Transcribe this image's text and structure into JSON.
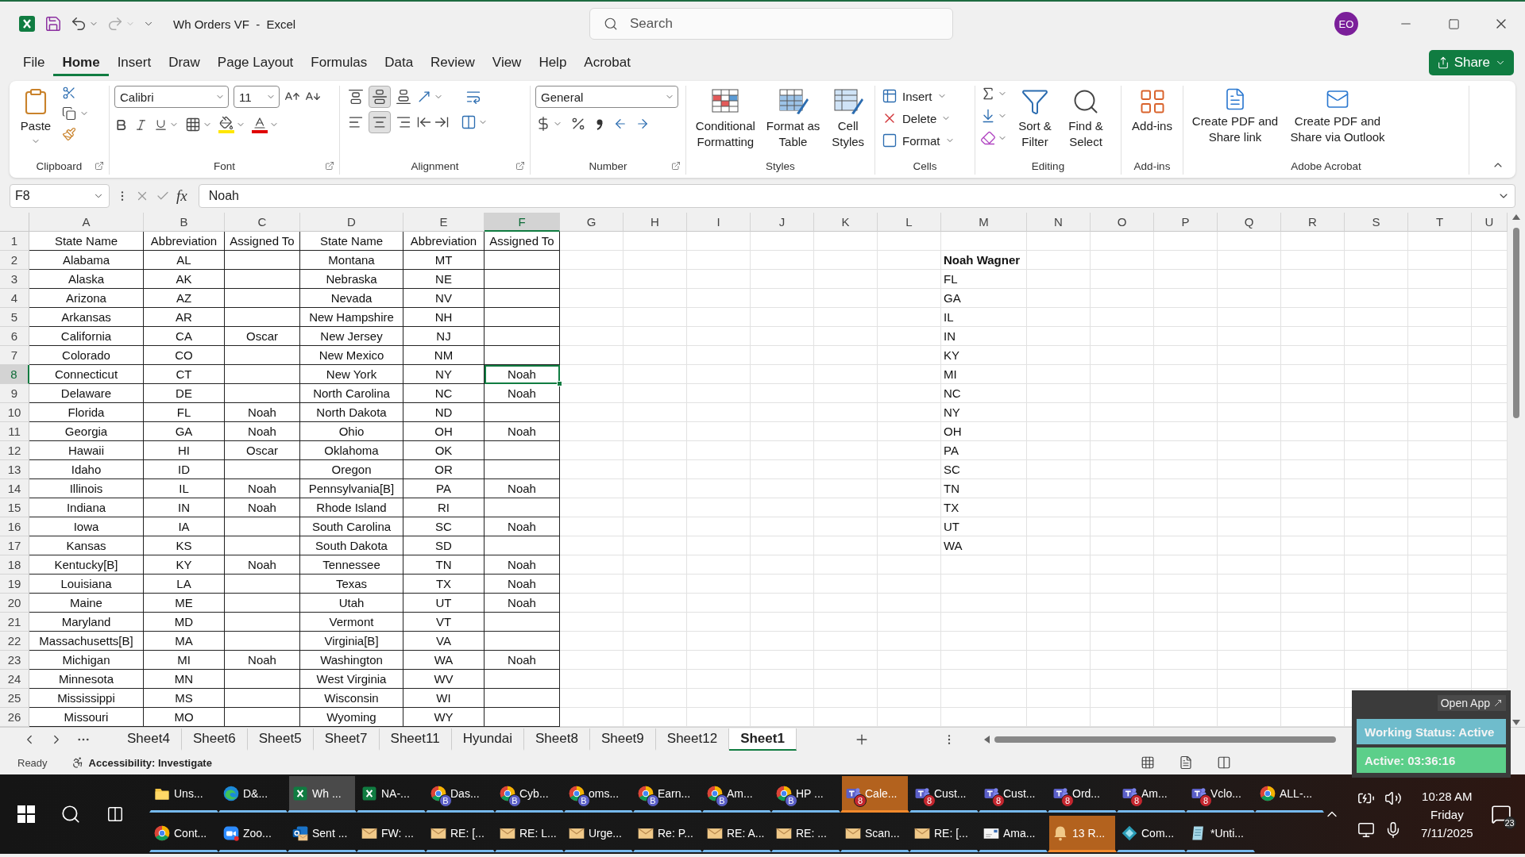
{
  "title_bar": {
    "title": "Wh Orders VF  -  Excel",
    "search_placeholder": "Search",
    "avatar": "EO"
  },
  "menu_tabs": [
    {
      "label": "File",
      "selected": false
    },
    {
      "label": "Home",
      "selected": true
    },
    {
      "label": "Insert",
      "selected": false
    },
    {
      "label": "Draw",
      "selected": false
    },
    {
      "label": "Page Layout",
      "selected": false
    },
    {
      "label": "Formulas",
      "selected": false
    },
    {
      "label": "Data",
      "selected": false
    },
    {
      "label": "Review",
      "selected": false
    },
    {
      "label": "View",
      "selected": false
    },
    {
      "label": "Help",
      "selected": false
    },
    {
      "label": "Acrobat",
      "selected": false
    }
  ],
  "share_button": "Share",
  "ribbon": {
    "groups": [
      {
        "kind": "clipboard",
        "label": "Clipboard",
        "launcher": true,
        "buttons": [
          "Paste"
        ]
      },
      {
        "kind": "font",
        "label": "Font",
        "launcher": true,
        "font_name": "Calibri",
        "font_size": "11"
      },
      {
        "kind": "alignment",
        "label": "Alignment",
        "launcher": true,
        "vertical_buttons": [
          {
            "selected": false
          },
          {
            "selected": true
          },
          {
            "selected": false
          }
        ],
        "horizontal_buttons": [
          {
            "selected": false
          },
          {
            "selected": true
          },
          {
            "selected": false
          }
        ]
      },
      {
        "kind": "number",
        "label": "Number",
        "launcher": true,
        "format": "General"
      },
      {
        "kind": "styles",
        "label": "Styles",
        "buttons": [
          "Conditional Formatting",
          "Format as Table",
          "Cell Styles"
        ]
      },
      {
        "kind": "cells",
        "label": "Cells",
        "buttons": [
          "Insert",
          "Delete",
          "Format"
        ]
      },
      {
        "kind": "editing",
        "label": "Editing",
        "buttons": [
          "Sort & Filter",
          "Find & Select"
        ]
      },
      {
        "kind": "addins",
        "label": "Add-ins",
        "buttons": [
          "Add-ins"
        ]
      },
      {
        "kind": "acrobat",
        "label": "Adobe Acrobat",
        "buttons": [
          "Create PDF and Share link",
          "Create PDF and Share via Outlook"
        ]
      }
    ]
  },
  "formula_bar": {
    "name_box": "F8",
    "fx": "fx",
    "value": "Noah"
  },
  "sheet": {
    "columns": [
      {
        "letter": "A",
        "selected": false
      },
      {
        "letter": "B",
        "selected": false
      },
      {
        "letter": "C",
        "selected": false
      },
      {
        "letter": "D",
        "selected": false
      },
      {
        "letter": "E",
        "selected": false
      },
      {
        "letter": "F",
        "selected": true
      },
      {
        "letter": "G",
        "selected": false
      },
      {
        "letter": "H",
        "selected": false
      },
      {
        "letter": "I",
        "selected": false
      },
      {
        "letter": "J",
        "selected": false
      },
      {
        "letter": "K",
        "selected": false
      },
      {
        "letter": "L",
        "selected": false
      },
      {
        "letter": "M",
        "selected": false
      },
      {
        "letter": "N",
        "selected": false
      },
      {
        "letter": "O",
        "selected": false
      },
      {
        "letter": "P",
        "selected": false
      },
      {
        "letter": "Q",
        "selected": false
      },
      {
        "letter": "R",
        "selected": false
      },
      {
        "letter": "S",
        "selected": false
      },
      {
        "letter": "T",
        "selected": false
      },
      {
        "letter": "U",
        "selected": false
      }
    ],
    "rows": [
      {
        "number": "1",
        "selected": false,
        "cells": {
          "A": "State Name",
          "B": "Abbreviation",
          "C": "Assigned To",
          "D": "State Name",
          "E": "Abbreviation",
          "F": "Assigned To"
        }
      },
      {
        "number": "2",
        "selected": false,
        "cells": {
          "A": "Alabama",
          "B": "AL",
          "D": "Montana",
          "E": "MT",
          "M": {
            "text": "Noah Wagner",
            "bold": true
          }
        }
      },
      {
        "number": "3",
        "selected": false,
        "cells": {
          "A": "Alaska",
          "B": "AK",
          "D": "Nebraska",
          "E": "NE",
          "M": "FL"
        }
      },
      {
        "number": "4",
        "selected": false,
        "cells": {
          "A": "Arizona",
          "B": "AZ",
          "D": "Nevada",
          "E": "NV",
          "M": "GA"
        }
      },
      {
        "number": "5",
        "selected": false,
        "cells": {
          "A": "Arkansas",
          "B": "AR",
          "D": "New Hampshire",
          "E": "NH",
          "M": "IL"
        }
      },
      {
        "number": "6",
        "selected": false,
        "cells": {
          "A": "California",
          "B": "CA",
          "C": "Oscar",
          "D": "New Jersey",
          "E": "NJ",
          "M": "IN"
        }
      },
      {
        "number": "7",
        "selected": false,
        "cells": {
          "A": "Colorado",
          "B": "CO",
          "D": "New Mexico",
          "E": "NM",
          "M": "KY"
        }
      },
      {
        "number": "8",
        "selected": true,
        "cells": {
          "A": "Connecticut",
          "B": "CT",
          "D": "New York",
          "E": "NY",
          "F": "Noah",
          "M": "MI"
        }
      },
      {
        "number": "9",
        "selected": false,
        "cells": {
          "A": "Delaware",
          "B": "DE",
          "D": "North Carolina",
          "E": "NC",
          "F": "Noah",
          "M": "NC"
        }
      },
      {
        "number": "10",
        "selected": false,
        "cells": {
          "A": "Florida",
          "B": "FL",
          "C": "Noah",
          "D": "North Dakota",
          "E": "ND",
          "M": "NY"
        }
      },
      {
        "number": "11",
        "selected": false,
        "cells": {
          "A": "Georgia",
          "B": "GA",
          "C": "Noah",
          "D": "Ohio",
          "E": "OH",
          "F": "Noah",
          "M": "OH"
        }
      },
      {
        "number": "12",
        "selected": false,
        "cells": {
          "A": "Hawaii",
          "B": "HI",
          "C": "Oscar",
          "D": "Oklahoma",
          "E": "OK",
          "M": "PA"
        }
      },
      {
        "number": "13",
        "selected": false,
        "cells": {
          "A": "Idaho",
          "B": "ID",
          "D": "Oregon",
          "E": "OR",
          "M": "SC"
        }
      },
      {
        "number": "14",
        "selected": false,
        "cells": {
          "A": "Illinois",
          "B": "IL",
          "C": "Noah",
          "D": "Pennsylvania[B]",
          "E": "PA",
          "F": "Noah",
          "M": "TN"
        }
      },
      {
        "number": "15",
        "selected": false,
        "cells": {
          "A": "Indiana",
          "B": "IN",
          "C": "Noah",
          "D": "Rhode Island",
          "E": "RI",
          "M": "TX"
        }
      },
      {
        "number": "16",
        "selected": false,
        "cells": {
          "A": "Iowa",
          "B": "IA",
          "D": "South Carolina",
          "E": "SC",
          "F": "Noah",
          "M": "UT"
        }
      },
      {
        "number": "17",
        "selected": false,
        "cells": {
          "A": "Kansas",
          "B": "KS",
          "D": "South Dakota",
          "E": "SD",
          "M": "WA"
        }
      },
      {
        "number": "18",
        "selected": false,
        "cells": {
          "A": "Kentucky[B]",
          "B": "KY",
          "C": "Noah",
          "D": "Tennessee",
          "E": "TN",
          "F": "Noah"
        }
      },
      {
        "number": "19",
        "selected": false,
        "cells": {
          "A": "Louisiana",
          "B": "LA",
          "D": "Texas",
          "E": "TX",
          "F": "Noah"
        }
      },
      {
        "number": "20",
        "selected": false,
        "cells": {
          "A": "Maine",
          "B": "ME",
          "D": "Utah",
          "E": "UT",
          "F": "Noah"
        }
      },
      {
        "number": "21",
        "selected": false,
        "cells": {
          "A": "Maryland",
          "B": "MD",
          "D": "Vermont",
          "E": "VT"
        }
      },
      {
        "number": "22",
        "selected": false,
        "cells": {
          "A": "Massachusetts[B]",
          "B": "MA",
          "D": "Virginia[B]",
          "E": "VA"
        }
      },
      {
        "number": "23",
        "selected": false,
        "cells": {
          "A": "Michigan",
          "B": "MI",
          "C": "Noah",
          "D": "Washington",
          "E": "WA",
          "F": "Noah"
        }
      },
      {
        "number": "24",
        "selected": false,
        "cells": {
          "A": "Minnesota",
          "B": "MN",
          "D": "West Virginia",
          "E": "WV"
        }
      },
      {
        "number": "25",
        "selected": false,
        "cells": {
          "A": "Mississippi",
          "B": "MS",
          "D": "Wisconsin",
          "E": "WI"
        }
      },
      {
        "number": "26",
        "selected": false,
        "cells": {
          "A": "Missouri",
          "B": "MO",
          "D": "Wyoming",
          "E": "WY"
        }
      }
    ]
  },
  "sheet_tabs": [
    {
      "label": "Sheet4",
      "selected": false
    },
    {
      "label": "Sheet6",
      "selected": false
    },
    {
      "label": "Sheet5",
      "selected": false
    },
    {
      "label": "Sheet7",
      "selected": false
    },
    {
      "label": "Sheet11",
      "selected": false
    },
    {
      "label": "Hyundai",
      "selected": false
    },
    {
      "label": "Sheet8",
      "selected": false
    },
    {
      "label": "Sheet9",
      "selected": false
    },
    {
      "label": "Sheet12",
      "selected": false
    },
    {
      "label": "Sheet1",
      "selected": true
    }
  ],
  "status_bar": {
    "mode": "Ready",
    "accessibility": "Accessibility: Investigate"
  },
  "tracker_widget": {
    "open_app": "Open App",
    "status": "Working Status: Active",
    "timer": "Active: 03:36:16"
  },
  "taskbar": {
    "rows": [
      [
        {
          "kind": "folder",
          "label": "Uns...",
          "selected": false,
          "attention": false
        },
        {
          "kind": "edge",
          "label": "D&...",
          "selected": false,
          "attention": false
        },
        {
          "kind": "excel",
          "label": "Wh ...",
          "selected": true,
          "attention": false
        },
        {
          "kind": "excel",
          "label": "NA-...",
          "selected": false,
          "attention": false
        },
        {
          "kind": "chrome",
          "badge": "B",
          "label": "Das...",
          "selected": false,
          "attention": false
        },
        {
          "kind": "chrome",
          "badge": "B",
          "label": "Cyb...",
          "selected": false,
          "attention": false
        },
        {
          "kind": "chrome",
          "badge": "B",
          "label": "oms...",
          "selected": false,
          "attention": false
        },
        {
          "kind": "chrome",
          "badge": "B",
          "label": "Earn...",
          "selected": false,
          "attention": false
        },
        {
          "kind": "chrome",
          "badge": "B",
          "label": "Am...",
          "selected": false,
          "attention": false
        },
        {
          "kind": "chrome",
          "badge": "B",
          "label": "HP ...",
          "selected": false,
          "attention": false
        },
        {
          "kind": "teams",
          "badge": "8",
          "label": "Cale...",
          "selected": false,
          "attention": true
        },
        {
          "kind": "teams",
          "badge": "8",
          "label": "Cust...",
          "selected": false,
          "attention": false
        },
        {
          "kind": "teams",
          "badge": "8",
          "label": "Cust...",
          "selected": false,
          "attention": false
        },
        {
          "kind": "teams",
          "badge": "8",
          "label": "Ord...",
          "selected": false,
          "attention": false
        },
        {
          "kind": "teams",
          "badge": "8",
          "label": "Am...",
          "selected": false,
          "attention": false
        },
        {
          "kind": "teams",
          "badge": "8",
          "label": "Vclo...",
          "selected": false,
          "attention": false
        },
        {
          "kind": "chrome",
          "label": "ALL-...",
          "selected": false,
          "attention": false
        }
      ],
      [
        {
          "kind": "chrome",
          "label": "Cont...",
          "selected": false,
          "attention": false
        },
        {
          "kind": "zoom",
          "label": "Zoo...",
          "selected": false,
          "attention": false
        },
        {
          "kind": "outlook",
          "label": "Sent ...",
          "selected": false,
          "attention": false
        },
        {
          "kind": "mail",
          "label": "FW: ...",
          "selected": false,
          "attention": false
        },
        {
          "kind": "mail",
          "label": "RE: [...",
          "selected": false,
          "attention": false
        },
        {
          "kind": "mail",
          "label": "RE: L...",
          "selected": false,
          "attention": false
        },
        {
          "kind": "mail",
          "label": "Urge...",
          "selected": false,
          "attention": false
        },
        {
          "kind": "mail",
          "label": "Re: P...",
          "selected": false,
          "attention": false
        },
        {
          "kind": "mail",
          "label": "RE: A...",
          "selected": false,
          "attention": false
        },
        {
          "kind": "mail",
          "label": "RE: ...",
          "selected": false,
          "attention": false
        },
        {
          "kind": "mail",
          "label": "Scan...",
          "selected": false,
          "attention": false
        },
        {
          "kind": "mail",
          "label": "RE: [...",
          "selected": false,
          "attention": false
        },
        {
          "kind": "letter",
          "label": "Ama...",
          "selected": false,
          "attention": false
        },
        {
          "kind": "bell",
          "label": "13 R...",
          "selected": false,
          "attention": true
        },
        {
          "kind": "diamond",
          "label": "Com...",
          "selected": false,
          "attention": false
        },
        {
          "kind": "notepad",
          "label": "*Unti...",
          "selected": false,
          "attention": false
        }
      ]
    ],
    "clock": {
      "time": "10:28 AM",
      "day": "Friday",
      "date": "7/11/2025"
    },
    "notifications": "23"
  }
}
